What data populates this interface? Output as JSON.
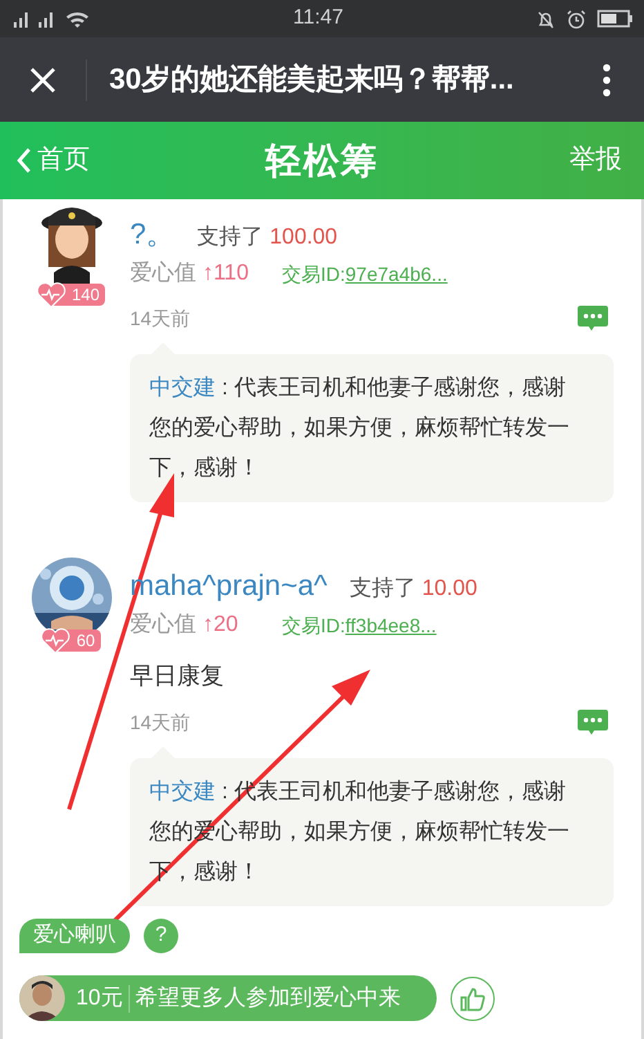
{
  "status_bar": {
    "time": "11:47"
  },
  "title_bar": {
    "title": "30岁的她还能美起来吗？帮帮..."
  },
  "header": {
    "back": "首页",
    "title": "轻松筹",
    "action": "举报"
  },
  "comments": [
    {
      "name": "?。",
      "supported_label": "支持了",
      "amount": "100.00",
      "love_label": "爱心值",
      "love_arrow": "↑",
      "love_value": "110",
      "tx_label": "交易ID:",
      "tx_id": "97e7a4b6...",
      "badge": "140",
      "time": "14天前",
      "reply": {
        "author": "中交建",
        "separator": ":",
        "text": "代表王司机和他妻子感谢您，感谢您的爱心帮助，如果方便，麻烦帮忙转发一下，感谢！"
      }
    },
    {
      "name": "maha^prajn~a^",
      "supported_label": "支持了",
      "amount": "10.00",
      "love_label": "爱心值",
      "love_arrow": "↑",
      "love_value": "20",
      "tx_label": "交易ID:",
      "tx_id": "ff3b4ee8...",
      "badge": "60",
      "message": "早日康复",
      "time": "14天前",
      "reply": {
        "author": "中交建",
        "separator": ":",
        "text": "代表王司机和他妻子感谢您，感谢您的爱心帮助，如果方便，麻烦帮忙转发一下，感谢！"
      }
    }
  ],
  "love_speaker": {
    "label": "爱心喇叭",
    "help": "?"
  },
  "ticker": {
    "amount": "10元",
    "message": "希望更多人参加到爱心中来"
  }
}
